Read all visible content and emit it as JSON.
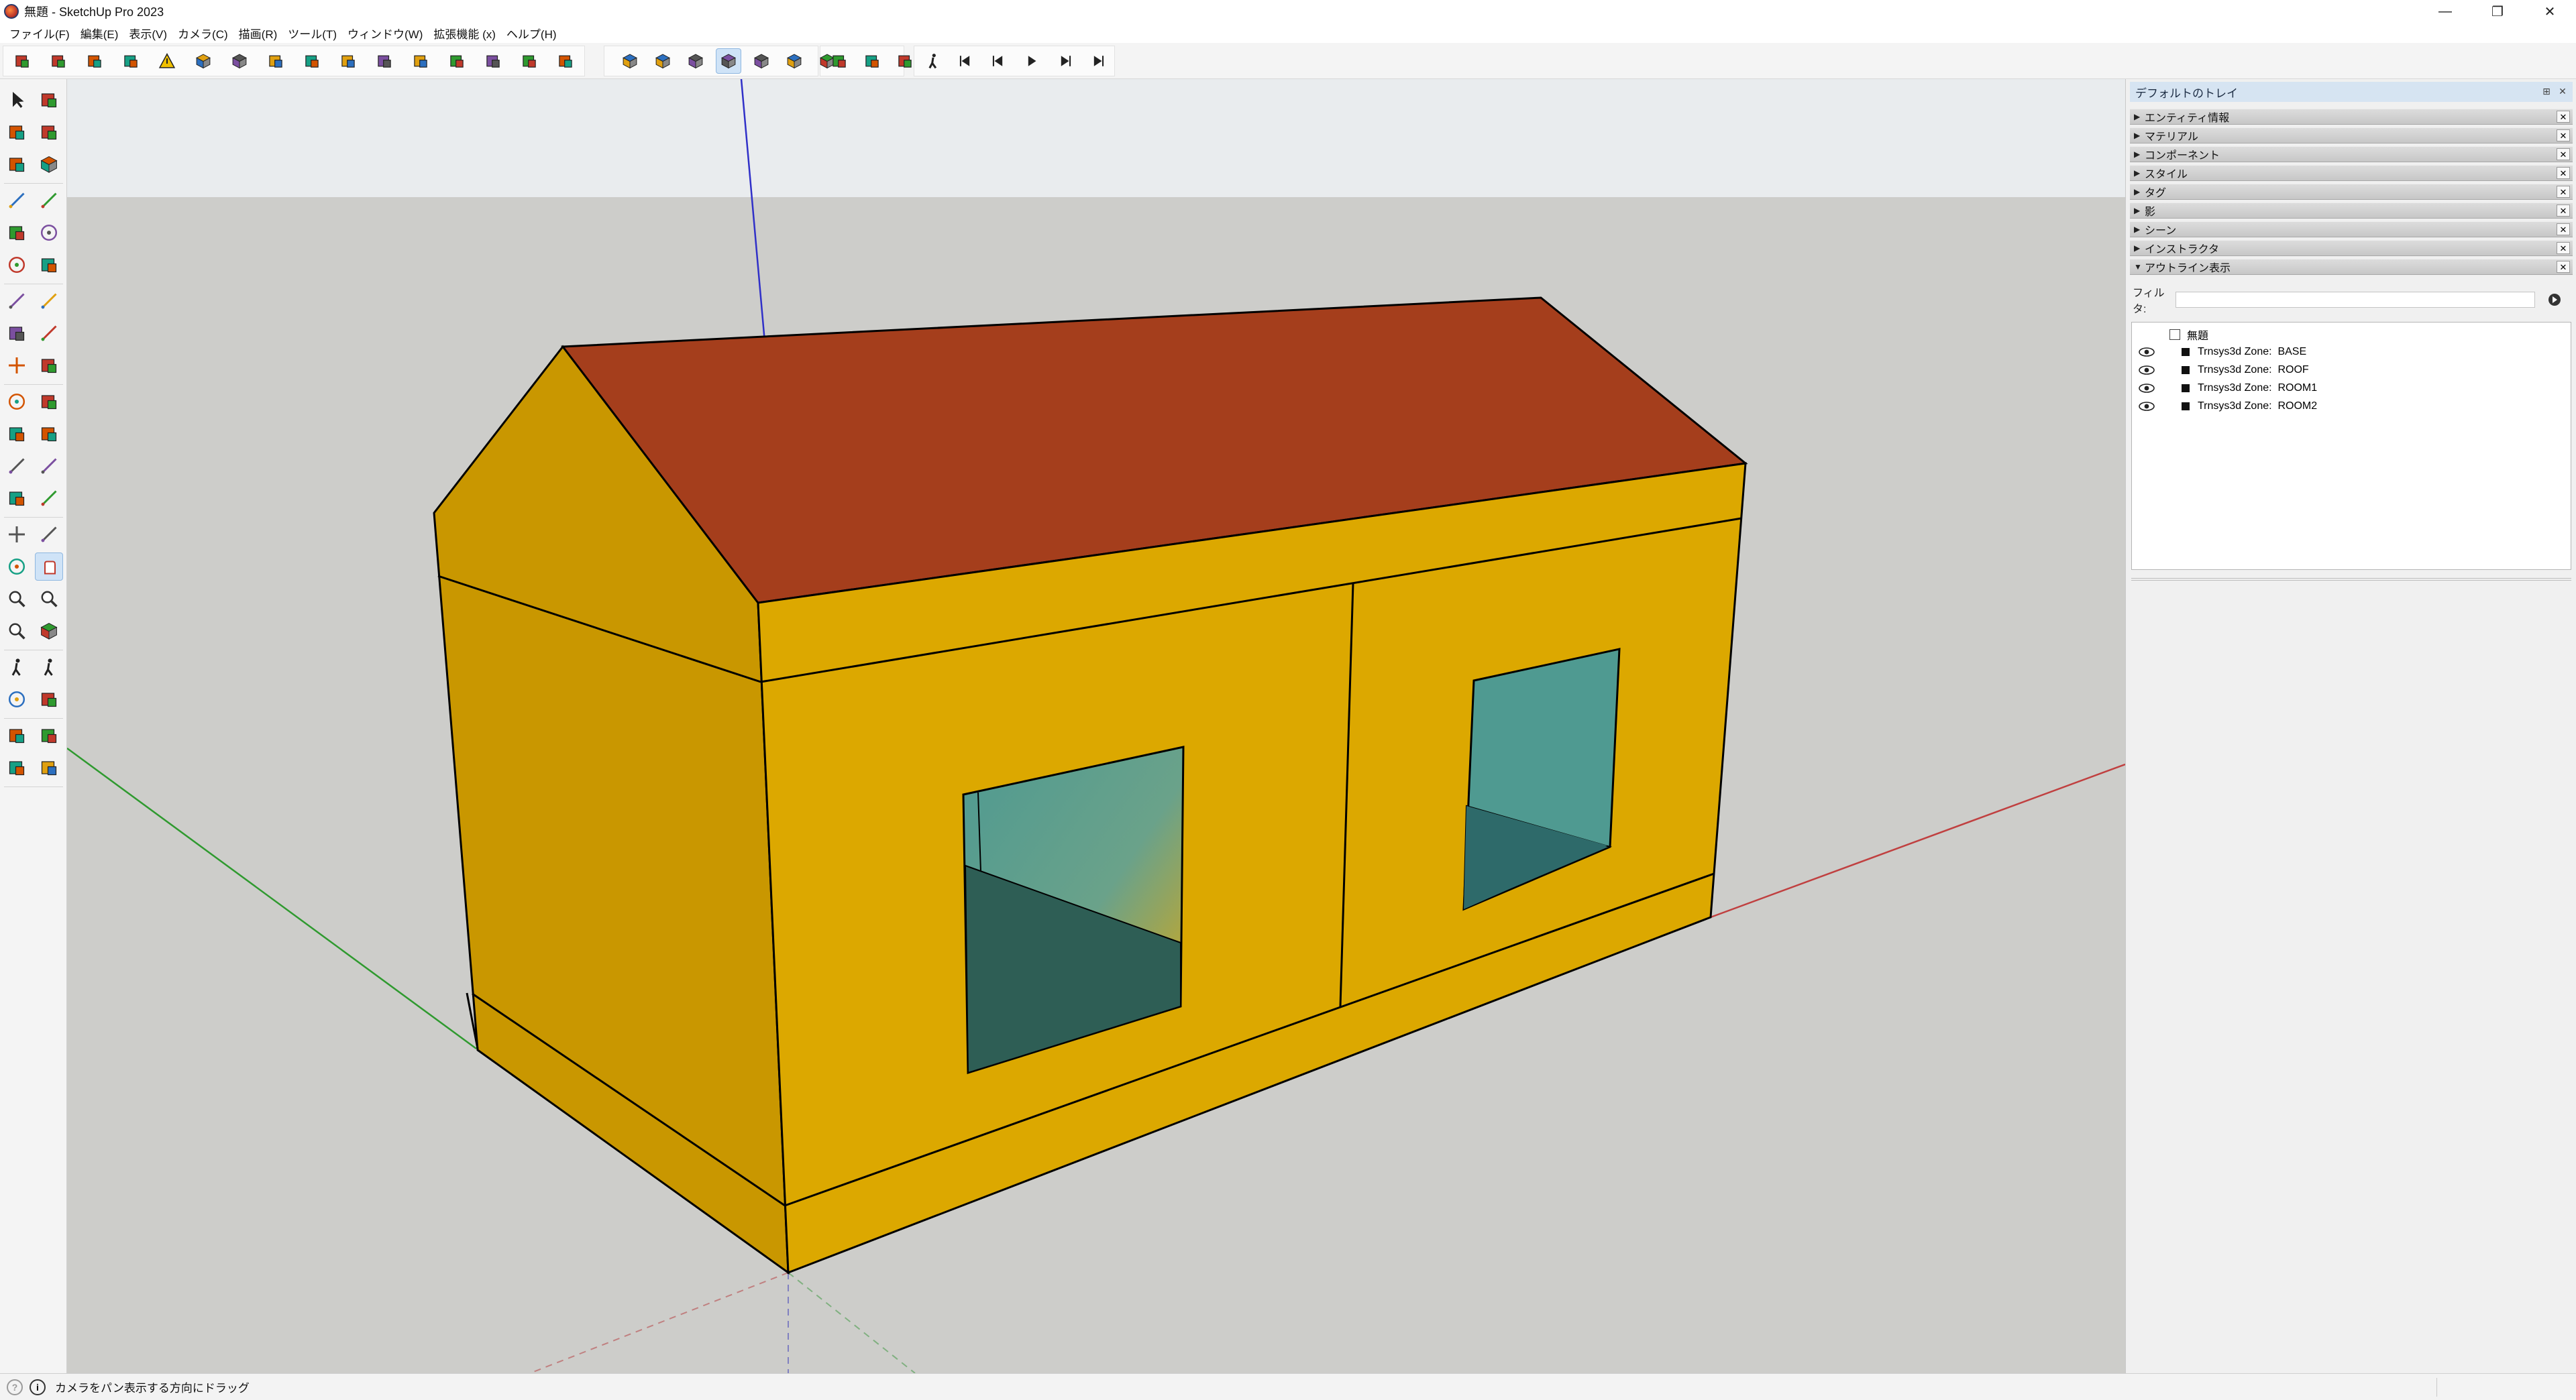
{
  "window": {
    "title": "無題 - SketchUp Pro 2023",
    "buttons": [
      "—",
      "❐",
      "✕"
    ]
  },
  "menubar": {
    "items": [
      "ファイル(F)",
      "編集(E)",
      "表示(V)",
      "カメラ(C)",
      "描画(R)",
      "ツール(T)",
      "ウィンドウ(W)",
      "拡張機能 (x)",
      "ヘルプ(H)"
    ]
  },
  "toolbar": {
    "icons": [
      "trnsys-new-icon",
      "trnsys-open-icon",
      "trnsys-save-icon",
      "trnsys-save-as-icon",
      "warning-icon",
      "zone-icon",
      "surface-icon",
      "boundary-icon",
      "window-icon",
      "door-icon",
      "shading-icon",
      "split-icon",
      "match-icon",
      "daylight-icon",
      "run-icon",
      "debug-icon",
      "iso-view-icon",
      "top-view-icon",
      "front-view-icon",
      "right-view-icon",
      "back-view-icon",
      "left-view-icon",
      "bottom-view-icon",
      "section-icon",
      "table-icon",
      "diagnose-icon",
      "camera-icon",
      "first-scene-icon",
      "prev-scene-icon",
      "play-icon",
      "next-scene-icon",
      "last-scene-icon"
    ],
    "active_icon": "right-view-icon"
  },
  "left_tools": {
    "icons": [
      "select-icon",
      "lasso-icon",
      "paint-bucket-icon",
      "eraser-icon",
      "tag-tool-icon",
      "cube-icon",
      "pencil-icon",
      "freehand-icon",
      "rectangle-icon",
      "rotated-rect-icon",
      "circle-icon",
      "polygon-icon",
      "arc-icon",
      "two-point-arc-icon",
      "pie-icon",
      "three-point-arc-icon",
      "move-icon",
      "push-pull-icon",
      "rotate-icon",
      "follow-me-icon",
      "scale-icon",
      "offset-icon",
      "tape-measure-icon",
      "dimension-icon",
      "protractor-icon",
      "text-icon",
      "axes-icon",
      "3d-text-icon",
      "orbit-icon",
      "pan-icon",
      "zoom-icon",
      "zoom-window-icon",
      "zoom-extents-icon",
      "previous-view-icon",
      "position-camera-icon",
      "walk-icon",
      "look-around-icon",
      "section-plane-icon",
      "sandbox-icon",
      "stamp-icon",
      "layers-icon",
      "drape-icon"
    ],
    "active_icon": "pan-icon"
  },
  "tray": {
    "title": "デフォルトのトレイ",
    "panels": [
      {
        "label": "エンティティ情報",
        "expanded": false
      },
      {
        "label": "マテリアル",
        "expanded": false
      },
      {
        "label": "コンポーネント",
        "expanded": false
      },
      {
        "label": "スタイル",
        "expanded": false
      },
      {
        "label": "タグ",
        "expanded": false
      },
      {
        "label": "影",
        "expanded": false
      },
      {
        "label": "シーン",
        "expanded": false
      },
      {
        "label": "インストラクタ",
        "expanded": false
      },
      {
        "label": "アウトライン表示",
        "expanded": true
      }
    ],
    "filter_label": "フィルタ:",
    "filter_value": "",
    "outliner": {
      "root": "無題",
      "items": [
        "Trnsys3d Zone:  BASE",
        "Trnsys3d Zone:  ROOF",
        "Trnsys3d Zone:  ROOM1",
        "Trnsys3d Zone:  ROOM2"
      ]
    }
  },
  "status": {
    "text": "カメラをパン表示する方向にドラッグ",
    "icons": [
      "geo-location-icon",
      "info-icon"
    ]
  },
  "colors": {
    "sky": "#e9ecee",
    "ground": "#cdcdca",
    "wall_front": "#dca800",
    "wall_side": "#c99700",
    "roof": "#a53e1c",
    "glass": "#4f9a91",
    "glass_dark": "#2e5e55",
    "axis_red": "#c04040",
    "axis_green": "#2f9a2f",
    "axis_blue": "#3030c8"
  }
}
